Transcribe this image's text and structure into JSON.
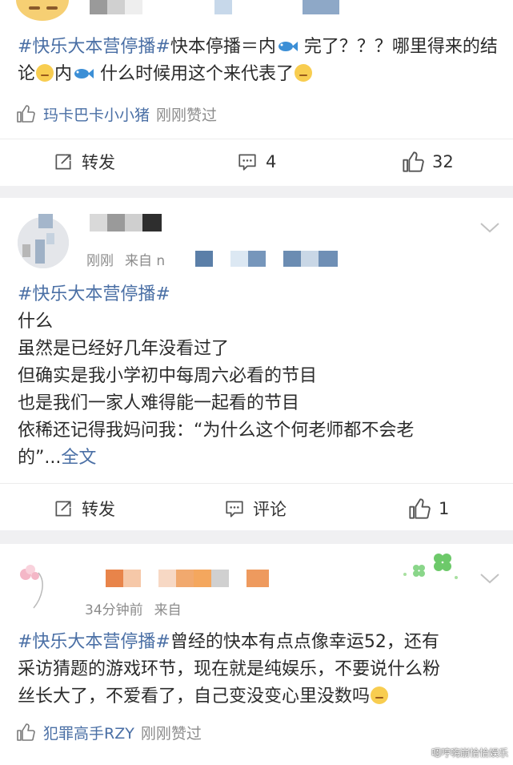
{
  "posts": [
    {
      "body": {
        "hashtag": "#快乐大本营停播#",
        "text1": "快本停播＝内",
        "text2": " 完了？？？哪里得来的结论",
        "text3": "内",
        "text4": " 什么时候用这个来代表了"
      },
      "liked_by": {
        "name": "玛卡巴卡小小猪",
        "suffix": "刚刚赞过"
      },
      "actions": {
        "repost": "转发",
        "comment": "4",
        "like": "32"
      },
      "icons": {
        "like_small": "thumb-up-icon",
        "repost": "repost-icon",
        "comment": "comment-icon",
        "like": "thumb-up-icon"
      }
    },
    {
      "meta": {
        "time": "刚刚",
        "from": "来自 n"
      },
      "body": {
        "hashtag": "#快乐大本营停播#",
        "lines": [
          "什么",
          "虽然是已经好几年没看过了",
          "但确实是我小学初中每周六必看的节目",
          "也是我们一家人难得能一起看的节目",
          "依稀还记得我妈问我：“为什么这个何老师都不会老"
        ],
        "last": "的”...",
        "more": "全文"
      },
      "actions": {
        "repost": "转发",
        "comment": "评论",
        "like": "1"
      }
    },
    {
      "meta": {
        "time": "34分钟前",
        "from": "来自"
      },
      "body": {
        "hashtag": "#快乐大本营停播#",
        "line1": "曾经的快本有点点像幸运52，还有",
        "line2": "采访猜题的游戏环节，现在就是纯娱乐，不要说什么粉",
        "line3": "丝长大了，不爱看了，自己变没变心里没数吗"
      },
      "liked_by": {
        "name": "犯罪高手RZY",
        "suffix": "刚刚赞过"
      }
    }
  ],
  "watermark": "嗯哼嗨崩恰恰娱乐",
  "colors": {
    "link": "#4a6fa5",
    "muted": "#8c8c8c",
    "bg": "#f0f0f2"
  }
}
